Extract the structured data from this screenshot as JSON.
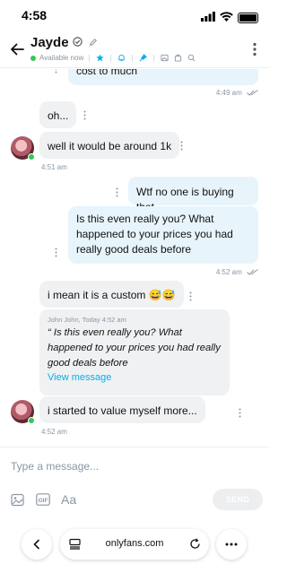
{
  "status_bar": {
    "time": "4:58"
  },
  "header": {
    "name": "Jayde",
    "status": "Available now"
  },
  "messages": {
    "m1": {
      "text": "cost to much",
      "time": "4:49 am"
    },
    "m2": {
      "text": "oh..."
    },
    "m3": {
      "text": "well it would be around 1k",
      "time": "4:51 am"
    },
    "m4": {
      "text": "Wtf no one is buying that"
    },
    "m5": {
      "text": "Is this even really you? What happened to your prices you had really good deals before",
      "time": "4:52 am"
    },
    "m6": {
      "text": "i mean it is a custom 😅😅"
    },
    "quote": {
      "header": "John John, Today 4:52 am",
      "text": "“ Is this even really you? What happened to your prices you had really good deals before",
      "link": "View message"
    },
    "m7": {
      "text": "i started to value myself more...",
      "time": "4:52 am"
    }
  },
  "composer": {
    "placeholder": "Type a message...",
    "font_label": "Aa",
    "send_label": "SEND"
  },
  "browser": {
    "url": "onlyfans.com"
  },
  "colors": {
    "accent": "#00aff0",
    "online": "#34c759",
    "out_bubble": "#e7f4fb",
    "in_bubble": "#f0f1f3"
  }
}
